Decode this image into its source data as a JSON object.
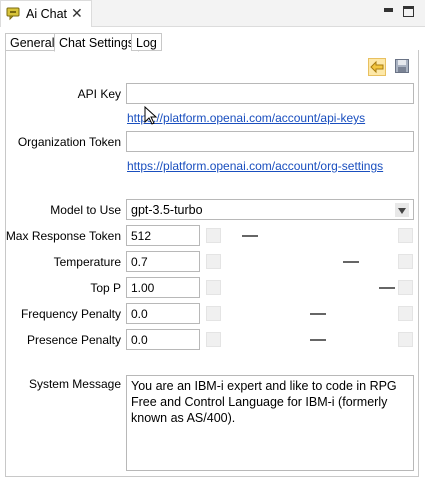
{
  "view": {
    "title": "Ai Chat",
    "close_glyph": "✕",
    "icon": "chat-bubble-icon"
  },
  "tabs": [
    {
      "label": "General",
      "active": false
    },
    {
      "label": "Chat Settings",
      "active": true
    },
    {
      "label": "Log",
      "active": false
    }
  ],
  "toolbar": {
    "restore_icon": "restore-defaults-icon",
    "save_icon": "save-icon"
  },
  "fields": {
    "api_key": {
      "label": "API Key",
      "value": "",
      "link": "https://platform.openai.com/account/api-keys"
    },
    "org_token": {
      "label": "Organization Token",
      "value": "",
      "link": "https://platform.openai.com/account/org-settings"
    },
    "model": {
      "label": "Model to Use",
      "value": "gpt-3.5-turbo"
    },
    "max_tokens": {
      "label": "Max Response Token",
      "value": "512"
    },
    "temperature": {
      "label": "Temperature",
      "value": "0.7"
    },
    "top_p": {
      "label": "Top P",
      "value": "1.00"
    },
    "frequency_penalty": {
      "label": "Frequency Penalty",
      "value": "0.0"
    },
    "presence_penalty": {
      "label": "Presence Penalty",
      "value": "0.0"
    },
    "system_message": {
      "label": "System Message",
      "value": "You are an IBM-i expert and like to code in RPG Free and Control Language for IBM-i (formerly known as AS/400)."
    }
  },
  "colors": {
    "link": "#1a4fbf",
    "accent_icon": "#e8a317"
  }
}
